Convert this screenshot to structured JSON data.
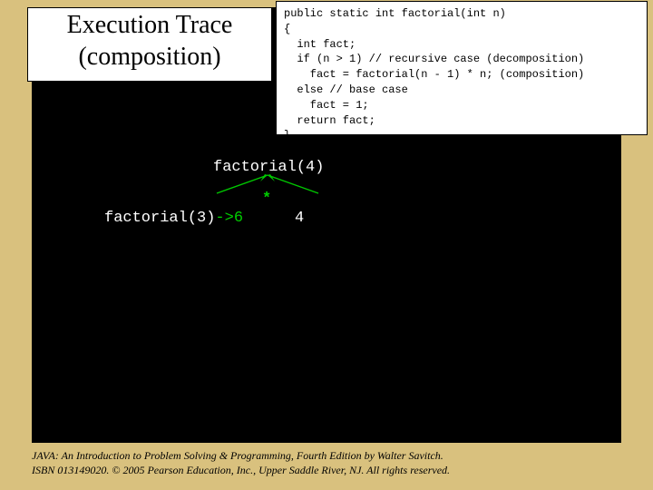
{
  "title": {
    "line1": "Execution Trace",
    "line2": "(composition)"
  },
  "code": {
    "l1": "public static int factorial(int n)",
    "l2": "{",
    "l3": "  int fact;",
    "l4": "  if (n > 1) // recursive case (decomposition)",
    "l5": "    fact = factorial(n - 1) * n; (composition)",
    "l6": "  else // base case",
    "l7": "    fact = 1;",
    "l8": "  return fact;",
    "l9": "}"
  },
  "trace": {
    "root_call": "factorial(4)",
    "op": "*",
    "left_call": "factorial(3)",
    "left_result": "->6",
    "right_operand": "4"
  },
  "footer": {
    "l1_a": "JAVA: An Introduction to Problem Solving & Programming",
    "l1_b": ", Fourth Edition by Walter Savitch.",
    "l2": "ISBN 013149020. © 2005 Pearson Education, Inc., Upper Saddle River, NJ. All rights reserved."
  }
}
